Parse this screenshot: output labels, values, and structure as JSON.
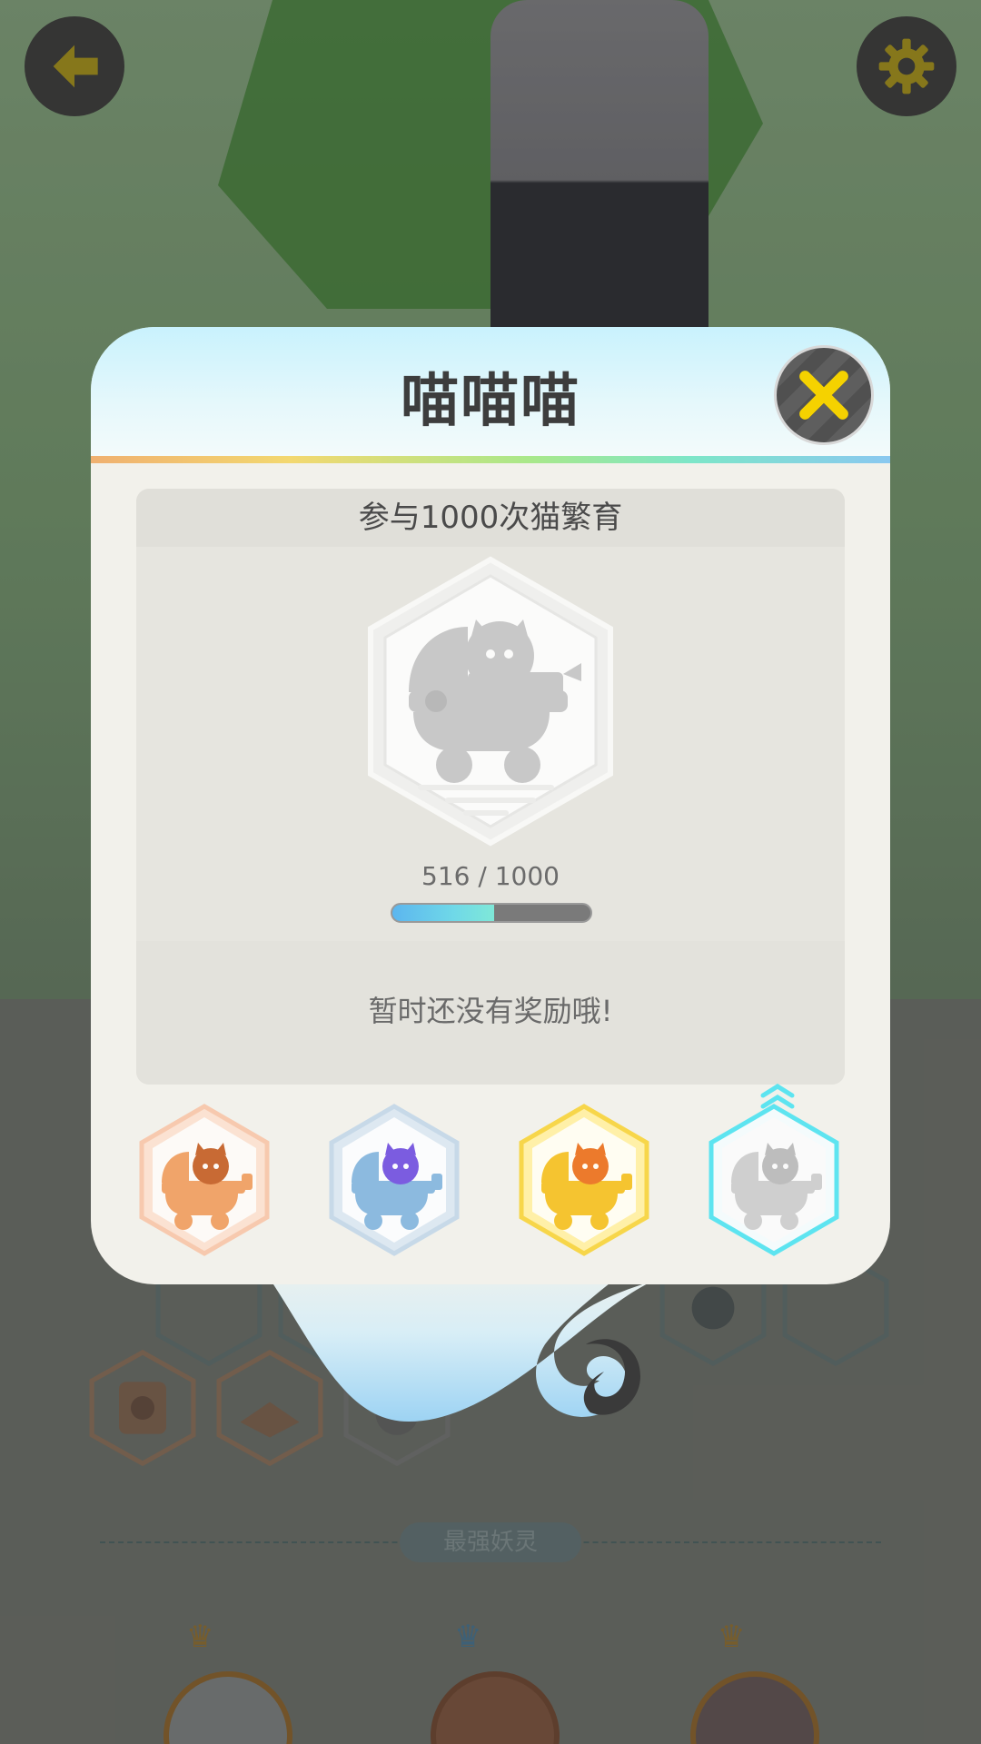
{
  "dialog": {
    "title": "喵喵喵",
    "close_icon": "close-x-icon"
  },
  "achievement": {
    "description": "参与1000次猫繁育",
    "badge_icon": "cat-stroller-icon",
    "progress": {
      "label": "516 / 1000",
      "current": 516,
      "target": 1000,
      "fraction": 0.516
    },
    "reward_text": "暂时还没有奖励哦!"
  },
  "tiers": [
    {
      "name": "bronze",
      "color": "#f0a46a",
      "state": "earned"
    },
    {
      "name": "silver",
      "color": "#8cbadf",
      "state": "earned"
    },
    {
      "name": "gold",
      "color": "#f5c430",
      "state": "earned"
    },
    {
      "name": "diamond",
      "color": "#5de4f0",
      "state": "current"
    }
  ],
  "background": {
    "section_label": "最强妖灵",
    "back_icon": "back-arrow-icon",
    "settings_icon": "gear-icon"
  },
  "colors": {
    "accent_yellow": "#f5d200",
    "progress_blue": "#5cb6ef",
    "progress_teal": "#7fe8d8"
  }
}
